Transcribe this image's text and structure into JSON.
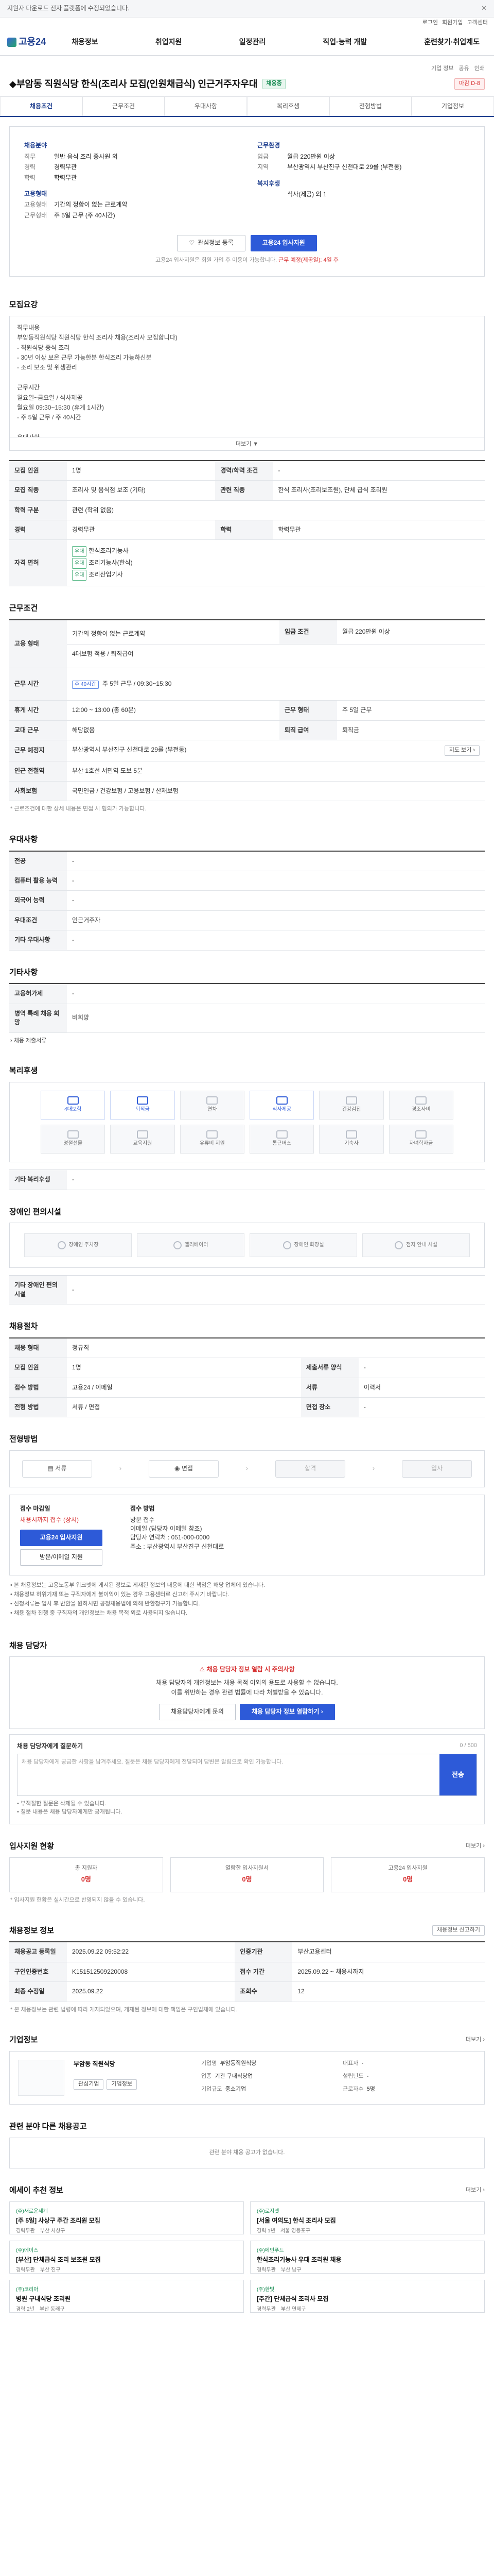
{
  "topbar": {
    "notice": "지원자 다운로드 전자 플랫폼에 수정되었습니다.",
    "close": "✕"
  },
  "util": [
    "로그인",
    "회원가입",
    "고객센터"
  ],
  "header": {
    "logo": "고용24",
    "nav": [
      "채용정보",
      "취업지원",
      "일정관리",
      "직업·능력 개발",
      "훈련찾기·취업제도"
    ]
  },
  "title": {
    "meta": [
      "기업 정보",
      "공유",
      "인쇄"
    ],
    "text": "◆부암동 직원식당 한식(조리사 모집(인원채급식) 인근거주자우대",
    "badge": "채용중",
    "dday": "마감 D-8"
  },
  "tabs": [
    "채용조건",
    "근무조건",
    "우대사항",
    "복리후생",
    "전형방법",
    "기업정보"
  ],
  "summary": {
    "left": [
      {
        "h": "채용분야",
        "rows": []
      },
      {
        "h": "",
        "rows": [
          {
            "k": "직무",
            "v": "일반 음식 조리 종사원 외"
          },
          {
            "k": "경력",
            "v": "경력무관"
          },
          {
            "k": "학력",
            "v": "학력무관"
          }
        ]
      },
      {
        "h": "고용형태",
        "rows": [
          {
            "k": "고용형태",
            "v": "기간의 정함이 없는 근로계약"
          },
          {
            "k": "근무형태",
            "v": "주 5일 근무 (주 40시간)"
          }
        ]
      }
    ],
    "right": [
      {
        "h": "근무환경",
        "rows": [
          {
            "k": "임금",
            "v": "월급 220만원 이상"
          },
          {
            "k": "지역",
            "v": "부산광역시 부산진구 신천대로 29를 (부전동)"
          }
        ]
      },
      {
        "h": "복지후생",
        "rows": [
          {
            "k": "",
            "v": "식사(제공) 외 1"
          }
        ]
      }
    ],
    "interest_btn": "관심정보 등록",
    "apply_btn": "고용24 입사지원",
    "note": "고용24 입사지원은 회원 가입 후 이용이 가능합니다.",
    "note_red": "근무 예정(제공일): 4일 후"
  },
  "recruit": {
    "title": "모집요강",
    "body": [
      "직무내용",
      "부암동직원식당 직원식당 한식 조리사 채용(조리사 모집합니다)",
      "- 직원식당 중식 조리",
      "- 30년 이상 보온 근무 가능한분 한식조리 가능하신분",
      "- 조리 보조 및 위생관리",
      "",
      "근무시간",
      "월요일~금요일 / 식사제공",
      "월요일 09:30~15:30 (휴게 1시간)",
      "- 주 5일 근무 / 주 40시간",
      "",
      "우대사항",
      "- 한식조리기능사 자격증 소지자",
      "- 인근거주자"
    ],
    "fold": "더보기 ▼",
    "table": [
      {
        "k": "모집 인원",
        "v": "1명",
        "k2": "경력/학력 조건",
        "v2": "-"
      },
      {
        "k": "모집 직종",
        "v": "조리사 및 음식점 보조 (기타)",
        "k2": "관련 직종",
        "v2": "한식 조리사(조리보조원), 단체 급식 조리원"
      },
      {
        "k": "학력 구분",
        "v": "관련 (학위 없음)",
        "k2": "",
        "v2": ""
      },
      {
        "k": "경력",
        "v": "경력무관",
        "k2": "학력",
        "v2": "학력무관"
      },
      {
        "k": "자격 면허",
        "v": "한식조리기능사 / 조리기능사 / 영양사",
        "k2": "",
        "v2": ""
      }
    ],
    "licenses": [
      "한식조리기능사",
      "조리기능사(한식)",
      "조리산업기사"
    ],
    "license_tags": [
      "우대",
      "우대",
      "우대"
    ]
  },
  "work": {
    "title": "근무조건",
    "table": [
      {
        "k": "고용 형태",
        "v": "기간의 정함이 없는 근로계약",
        "k2": "임금 조건",
        "v2": "월급 220만원 이상"
      },
      {
        "k": "",
        "v": "4대보험 적용 / 퇴직급여",
        "k2": "",
        "v2": ""
      },
      {
        "k": "근무 시간",
        "v": "주 5일 근무 / 09:30~15:30",
        "k2": "",
        "v2": ""
      },
      {
        "k": "휴게 시간",
        "v": "12:00 ~ 13:00 (총 60분)",
        "k2": "근무 형태",
        "v2": "주 5일 근무"
      },
      {
        "k": "교대 근무",
        "v": "해당없음",
        "k2": "퇴직 급여",
        "v2": "퇴직금"
      },
      {
        "k": "근무 예정지",
        "v": "부산광역시 부산진구 신천대로 29를 (부전동)",
        "k2": "",
        "v2": ""
      },
      {
        "k": "인근 전철역",
        "v": "부산 1호선 서면역 도보 5분",
        "k2": "",
        "v2": ""
      },
      {
        "k": "사회보험",
        "v": "국민연금 / 건강보험 / 고용보험 / 산재보험",
        "k2": "",
        "v2": ""
      }
    ],
    "map_btn": "지도 보기 ›",
    "week_tag": "주 40시간",
    "note": "* 근로조건에 대한 상세 내용은 면접 시 협의가 가능합니다."
  },
  "prefer": {
    "title": "우대사항",
    "rows": [
      {
        "k": "전공",
        "v": "-"
      },
      {
        "k": "컴퓨터 활용 능력",
        "v": "-"
      },
      {
        "k": "외국어 능력",
        "v": "-"
      },
      {
        "k": "우대조건",
        "v": "인근거주자"
      },
      {
        "k": "기타 우대사항",
        "v": "-"
      }
    ]
  },
  "etc": {
    "title": "기타사항",
    "rows": [
      {
        "k": "고용허가제",
        "v": "-"
      },
      {
        "k": "병역 특례 채용 희망",
        "v": "비희망"
      }
    ],
    "link": "› 채용 제출서류"
  },
  "welfare": {
    "title": "복리후생",
    "items": [
      "4대보험",
      "퇴직금",
      "연차",
      "식사제공",
      "건강검진",
      "경조사비",
      "명절선물",
      "교육지원",
      "유류비 지원",
      "통근버스",
      "기숙사",
      "자녀학자금"
    ],
    "active": [
      0,
      1,
      3
    ],
    "etc_label": "기타 복리후생",
    "etc_value": "-"
  },
  "disabled": {
    "title": "장애인 편의시설",
    "items": [
      "장애인 주차장",
      "엘리베이터",
      "장애인 화장실",
      "점자 안내 시설"
    ],
    "etc_label": "기타 장애인 편의시설",
    "etc_value": "-"
  },
  "selection": {
    "title": "채용절차",
    "rows": [
      {
        "k": "채용 형태",
        "v": "정규직",
        "k2": "",
        "v2": ""
      },
      {
        "k": "모집 인원",
        "v": "1명",
        "k2": "제출서류 양식",
        "v2": "-"
      },
      {
        "k": "접수 방법",
        "v": "고용24 / 이메일",
        "k2": "서류",
        "v2": "이력서"
      },
      {
        "k": "전형 방법",
        "v": "서류 / 면접",
        "k2": "면접 장소",
        "v2": "-"
      }
    ]
  },
  "process": {
    "title": "전형방법",
    "steps": [
      "서류",
      "면접",
      "합격",
      "입사"
    ],
    "apply_left": {
      "label": "접수 마감일",
      "date": "채용시까지 접수 (상시)",
      "btn": "고용24 입사지원",
      "btn2": "방문/이메일 지원"
    },
    "apply_right": {
      "label": "접수 방법",
      "lines": [
        "방문 접수",
        "이메일 (담당자 이메일 참조)",
        "담당자 연락처 : 051-000-0000",
        "주소 : 부산광역시 부산진구 신천대로"
      ]
    },
    "bullets": [
      "• 본 채용정보는 고용노동부 워크넷에 게시된 정보로 게재된 정보의 내용에 대한 책임은 해당 업체에 있습니다.",
      "• 채용정보 허위기재 또는 구직자에게 불이익이 있는 경우 고용센터로 신고해 주시기 바랍니다.",
      "• 신청서류는 입사 후 반환을 원하시면 공정채용법에 의해 반환청구가 가능합니다.",
      "• 채용 절차 진행 중 구직자의 개인정보는 채용 목적 외로 사용되지 않습니다."
    ]
  },
  "contact": {
    "title": "채용 담당자",
    "warn_head": "⚠ 채용 담당자 정보 열람 시 주의사항",
    "warn_lines": [
      "채용 담당자의 개인정보는 채용 목적 이외의 용도로 사용할 수 없습니다.",
      "이를 위반하는 경우 관련 법률에 따라 처벌받을 수 있습니다."
    ],
    "btn1": "채용담당자에게 문의",
    "btn2": "채용 담당자 정보 열람하기 ›",
    "inq_label": "채용 담당자에게 질문하기",
    "inq_count": "0 / 500",
    "inq_placeholder": "채용 담당자에게 궁금한 사항을 남겨주세요. 질문은 채용 담당자에게 전달되며 답변은 알림으로 확인 가능합니다.",
    "inq_btn": "전송",
    "notes": [
      "• 부적절한 질문은 삭제될 수 있습니다.",
      "• 질문 내용은 채용 담당자에게만 공개됩니다."
    ]
  },
  "stats": {
    "title": "입사지원 현황",
    "more": "더보기 ›",
    "items": [
      {
        "t": "총 지원자",
        "n": "0명"
      },
      {
        "t": "열람한 입사지원서",
        "n": "0명"
      },
      {
        "t": "고용24 입사지원",
        "n": "0명"
      }
    ],
    "note": "* 입사지원 현황은 실시간으로 반영되지 않을 수 있습니다."
  },
  "info": {
    "title": "채용정보 정보",
    "btn": "채용정보 신고하기",
    "rows": [
      {
        "k": "채용공고 등록일",
        "v": "2025.09.22 09:52:22",
        "k2": "인증기관",
        "v2": "부산고용센터"
      },
      {
        "k": "구인인증번호",
        "v": "K151512509220008",
        "k2": "접수 기간",
        "v2": "2025.09.22 ~ 채용시까지"
      },
      {
        "k": "최종 수정일",
        "v": "2025.09.22",
        "k2": "조회수",
        "v2": "12"
      }
    ],
    "note": "* 본 채용정보는 관련 법령에 따라 게재되었으며, 게재된 정보에 대한 책임은 구인업체에 있습니다."
  },
  "company": {
    "title": "기업정보",
    "more": "더보기 ›",
    "name": "부암동 직원식당",
    "btns": [
      "관심기업",
      "기업정보"
    ],
    "grid": [
      {
        "k": "기업명",
        "v": "부암동직원식당"
      },
      {
        "k": "대표자",
        "v": "-"
      },
      {
        "k": "업종",
        "v": "기관 구내식당업"
      },
      {
        "k": "설립년도",
        "v": "-"
      },
      {
        "k": "기업규모",
        "v": "중소기업"
      },
      {
        "k": "근로자수",
        "v": "5명"
      }
    ]
  },
  "related_empty": {
    "title": "관련 분야 다른 채용공고",
    "msg": "관련 분야 채용 공고가 없습니다."
  },
  "recommend": {
    "title": "에세이 추천 정보",
    "more": "더보기 ›",
    "cards": [
      {
        "co": "(주)새로운세계",
        "tt": "[주 5일] 사상구 주간 조리원 모집",
        "m1": "경력무관",
        "m2": "부산 사상구"
      },
      {
        "co": "(주)로지넷",
        "tt": "[서울 여의도] 한식 조리사 모집",
        "m1": "경력 1년",
        "m2": "서울 영등포구"
      },
      {
        "co": "(주)에이스",
        "tt": "[부산] 단체급식 조리 보조원 모집",
        "m1": "경력무관",
        "m2": "부산 진구"
      },
      {
        "co": "(주)메인푸드",
        "tt": "한식조리기능사 우대 조리원 채용",
        "m1": "경력무관",
        "m2": "부산 남구"
      },
      {
        "co": "(주)코리아",
        "tt": "병원 구내식당 조리원",
        "m1": "경력 2년",
        "m2": "부산 동래구"
      },
      {
        "co": "(주)한빛",
        "tt": "[주간] 단체급식 조리사 모집",
        "m1": "경력무관",
        "m2": "부산 연제구"
      }
    ]
  }
}
